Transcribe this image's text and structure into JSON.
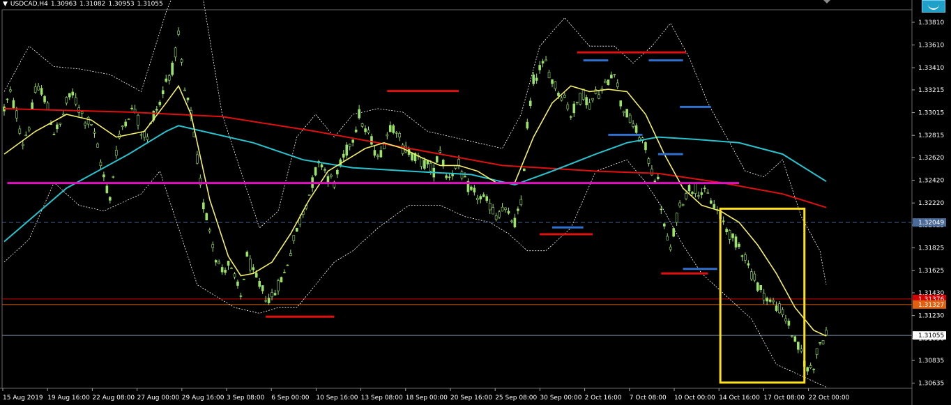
{
  "header": {
    "triangle": "▼",
    "symbol": "USDCAD,H4",
    "ohlc": [
      "1.30963",
      "1.31082",
      "1.30953",
      "1.31055"
    ]
  },
  "icons": {
    "corner_button": "chart-shift-icon",
    "top_arrow": "scroll-marker-icon"
  },
  "chart_data": {
    "type": "candlestick",
    "symbol": "USDCAD",
    "timeframe": "H4",
    "y_ticks": [
      "1.33810",
      "1.33610",
      "1.33410",
      "1.33215",
      "1.33015",
      "1.32815",
      "1.32620",
      "1.32420",
      "1.32220",
      "1.32025",
      "1.31825",
      "1.31625",
      "1.31430",
      "1.31230",
      "1.31030",
      "1.30835",
      "1.30635"
    ],
    "ylim": [
      1.3059,
      1.3392
    ],
    "x_labels": [
      "15 Aug 2019",
      "19 Aug 16:00",
      "22 Aug 08:00",
      "27 Aug 00:00",
      "29 Aug 16:00",
      "3 Sep 08:00",
      "6 Sep 00:00",
      "10 Sep 16:00",
      "13 Sep 08:00",
      "18 Sep 00:00",
      "20 Sep 16:00",
      "25 Sep 08:00",
      "30 Sep 00:00",
      "2 Oct 16:00",
      "7 Oct 08:00",
      "10 Oct 00:00",
      "14 Oct 16:00",
      "17 Oct 08:00",
      "22 Oct 00:00"
    ],
    "price_boxes": [
      {
        "label": "1.32049",
        "value": 1.32049,
        "color": "#4a6a9a",
        "line": "dashed"
      },
      {
        "label": "1.31376",
        "value": 1.31376,
        "color": "#d40000",
        "line": "solid"
      },
      {
        "label": "1.31327",
        "value": 1.31327,
        "color": "#e06010",
        "line": "solid"
      },
      {
        "label": "1.31055",
        "value": 1.31055,
        "color": "#ffffff",
        "line": "solid"
      }
    ],
    "price_path": [
      [
        0,
        1.3305
      ],
      [
        2,
        1.3318
      ],
      [
        4,
        1.33
      ],
      [
        6,
        1.3275
      ],
      [
        8,
        1.329
      ],
      [
        10,
        1.332
      ],
      [
        12,
        1.3322
      ],
      [
        14,
        1.3305
      ],
      [
        16,
        1.3285
      ],
      [
        18,
        1.329
      ],
      [
        20,
        1.331
      ],
      [
        22,
        1.3318
      ],
      [
        24,
        1.3305
      ],
      [
        26,
        1.3295
      ],
      [
        28,
        1.3292
      ],
      [
        30,
        1.327
      ],
      [
        32,
        1.3245
      ],
      [
        34,
        1.3225
      ],
      [
        36,
        1.3268
      ],
      [
        38,
        1.329
      ],
      [
        40,
        1.33
      ],
      [
        42,
        1.3305
      ],
      [
        44,
        1.3285
      ],
      [
        46,
        1.328
      ],
      [
        48,
        1.33
      ],
      [
        50,
        1.331
      ],
      [
        52,
        1.333
      ],
      [
        54,
        1.334
      ],
      [
        56,
        1.3368
      ],
      [
        58,
        1.332
      ],
      [
        60,
        1.33
      ],
      [
        62,
        1.326
      ],
      [
        64,
        1.322
      ],
      [
        66,
        1.32
      ],
      [
        68,
        1.3175
      ],
      [
        70,
        1.3162
      ],
      [
        72,
        1.3168
      ],
      [
        74,
        1.3155
      ],
      [
        76,
        1.314
      ],
      [
        78,
        1.3175
      ],
      [
        80,
        1.316
      ],
      [
        82,
        1.315
      ],
      [
        84,
        1.314
      ],
      [
        86,
        1.3138
      ],
      [
        88,
        1.315
      ],
      [
        90,
        1.316
      ],
      [
        92,
        1.318
      ],
      [
        94,
        1.3198
      ],
      [
        96,
        1.3215
      ],
      [
        98,
        1.323
      ],
      [
        100,
        1.325
      ],
      [
        102,
        1.3258
      ],
      [
        104,
        1.3245
      ],
      [
        106,
        1.324
      ],
      [
        108,
        1.3255
      ],
      [
        110,
        1.3268
      ],
      [
        112,
        1.328
      ],
      [
        114,
        1.33
      ],
      [
        116,
        1.3285
      ],
      [
        118,
        1.3278
      ],
      [
        120,
        1.326
      ],
      [
        122,
        1.3275
      ],
      [
        124,
        1.329
      ],
      [
        126,
        1.3288
      ],
      [
        128,
        1.327
      ],
      [
        130,
        1.3268
      ],
      [
        132,
        1.3262
      ],
      [
        134,
        1.3258
      ],
      [
        136,
        1.3255
      ],
      [
        138,
        1.325
      ],
      [
        140,
        1.327
      ],
      [
        142,
        1.3245
      ],
      [
        144,
        1.325
      ],
      [
        146,
        1.3255
      ],
      [
        148,
        1.324
      ],
      [
        150,
        1.3232
      ],
      [
        152,
        1.3228
      ],
      [
        154,
        1.3225
      ],
      [
        156,
        1.322
      ],
      [
        158,
        1.321
      ],
      [
        160,
        1.3218
      ],
      [
        162,
        1.321
      ],
      [
        164,
        1.3205
      ],
      [
        166,
        1.322
      ],
      [
        168,
        1.329
      ],
      [
        170,
        1.333
      ],
      [
        172,
        1.334
      ],
      [
        174,
        1.3345
      ],
      [
        176,
        1.333
      ],
      [
        178,
        1.332
      ],
      [
        180,
        1.3315
      ],
      [
        182,
        1.33
      ],
      [
        184,
        1.331
      ],
      [
        186,
        1.3318
      ],
      [
        188,
        1.3308
      ],
      [
        190,
        1.3318
      ],
      [
        192,
        1.332
      ],
      [
        194,
        1.333
      ],
      [
        196,
        1.334
      ],
      [
        198,
        1.331
      ],
      [
        200,
        1.33
      ],
      [
        202,
        1.329
      ],
      [
        204,
        1.328
      ],
      [
        206,
        1.327
      ],
      [
        208,
        1.325
      ],
      [
        210,
        1.324
      ],
      [
        212,
        1.32
      ],
      [
        214,
        1.318
      ],
      [
        216,
        1.321
      ],
      [
        218,
        1.3225
      ],
      [
        220,
        1.3235
      ],
      [
        222,
        1.3235
      ],
      [
        224,
        1.3232
      ],
      [
        226,
        1.3228
      ],
      [
        228,
        1.322
      ],
      [
        230,
        1.321
      ],
      [
        232,
        1.32
      ],
      [
        234,
        1.319
      ],
      [
        236,
        1.3185
      ],
      [
        238,
        1.3175
      ],
      [
        240,
        1.316
      ],
      [
        242,
        1.315
      ],
      [
        244,
        1.3142
      ],
      [
        246,
        1.3135
      ],
      [
        248,
        1.3132
      ],
      [
        250,
        1.3125
      ],
      [
        252,
        1.3115
      ],
      [
        254,
        1.31
      ],
      [
        256,
        1.309
      ],
      [
        258,
        1.3075
      ],
      [
        260,
        1.308
      ],
      [
        262,
        1.31
      ],
      [
        264,
        1.3105
      ]
    ],
    "n_bars": 265,
    "ma_fast": [
      [
        0,
        1.3265
      ],
      [
        10,
        1.3285
      ],
      [
        20,
        1.33
      ],
      [
        28,
        1.3295
      ],
      [
        36,
        1.328
      ],
      [
        45,
        1.3285
      ],
      [
        52,
        1.331
      ],
      [
        56,
        1.3325
      ],
      [
        60,
        1.33
      ],
      [
        66,
        1.3225
      ],
      [
        72,
        1.3175
      ],
      [
        76,
        1.3158
      ],
      [
        80,
        1.316
      ],
      [
        86,
        1.317
      ],
      [
        92,
        1.3195
      ],
      [
        98,
        1.3225
      ],
      [
        104,
        1.325
      ],
      [
        110,
        1.326
      ],
      [
        116,
        1.327
      ],
      [
        122,
        1.3275
      ],
      [
        128,
        1.327
      ],
      [
        134,
        1.3262
      ],
      [
        140,
        1.3255
      ],
      [
        146,
        1.3255
      ],
      [
        152,
        1.325
      ],
      [
        158,
        1.324
      ],
      [
        164,
        1.324
      ],
      [
        170,
        1.328
      ],
      [
        176,
        1.331
      ],
      [
        182,
        1.3325
      ],
      [
        188,
        1.332
      ],
      [
        194,
        1.3322
      ],
      [
        200,
        1.332
      ],
      [
        206,
        1.33
      ],
      [
        212,
        1.3265
      ],
      [
        218,
        1.3235
      ],
      [
        224,
        1.322
      ],
      [
        230,
        1.3215
      ],
      [
        236,
        1.3205
      ],
      [
        242,
        1.3185
      ],
      [
        248,
        1.316
      ],
      [
        254,
        1.313
      ],
      [
        260,
        1.311
      ],
      [
        264,
        1.3105
      ]
    ],
    "ma_mid": [
      [
        0,
        1.3188
      ],
      [
        20,
        1.3235
      ],
      [
        40,
        1.3265
      ],
      [
        52,
        1.3285
      ],
      [
        56,
        1.329
      ],
      [
        64,
        1.3285
      ],
      [
        80,
        1.3275
      ],
      [
        96,
        1.326
      ],
      [
        112,
        1.3253
      ],
      [
        130,
        1.325
      ],
      [
        150,
        1.3247
      ],
      [
        164,
        1.3238
      ],
      [
        176,
        1.325
      ],
      [
        190,
        1.3265
      ],
      [
        200,
        1.3275
      ],
      [
        210,
        1.328
      ],
      [
        222,
        1.3278
      ],
      [
        236,
        1.3275
      ],
      [
        250,
        1.3265
      ],
      [
        264,
        1.3241
      ]
    ],
    "ma_slow": [
      [
        0,
        1.3305
      ],
      [
        40,
        1.3302
      ],
      [
        70,
        1.3298
      ],
      [
        100,
        1.3285
      ],
      [
        130,
        1.327
      ],
      [
        160,
        1.3255
      ],
      [
        190,
        1.325
      ],
      [
        210,
        1.3248
      ],
      [
        230,
        1.324
      ],
      [
        250,
        1.323
      ],
      [
        264,
        1.3218
      ]
    ],
    "bb_upper": [
      [
        0,
        1.332
      ],
      [
        8,
        1.336
      ],
      [
        16,
        1.3342
      ],
      [
        24,
        1.334
      ],
      [
        34,
        1.3335
      ],
      [
        44,
        1.332
      ],
      [
        52,
        1.339
      ],
      [
        58,
        1.343
      ],
      [
        64,
        1.34
      ],
      [
        70,
        1.33
      ],
      [
        76,
        1.325
      ],
      [
        82,
        1.32
      ],
      [
        88,
        1.3215
      ],
      [
        94,
        1.328
      ],
      [
        100,
        1.33
      ],
      [
        106,
        1.328
      ],
      [
        112,
        1.33
      ],
      [
        120,
        1.3305
      ],
      [
        128,
        1.3302
      ],
      [
        136,
        1.3285
      ],
      [
        144,
        1.328
      ],
      [
        152,
        1.3275
      ],
      [
        160,
        1.327
      ],
      [
        166,
        1.33
      ],
      [
        172,
        1.336
      ],
      [
        180,
        1.3385
      ],
      [
        188,
        1.336
      ],
      [
        196,
        1.336
      ],
      [
        202,
        1.3345
      ],
      [
        208,
        1.336
      ],
      [
        214,
        1.338
      ],
      [
        220,
        1.335
      ],
      [
        226,
        1.331
      ],
      [
        232,
        1.328
      ],
      [
        238,
        1.325
      ],
      [
        244,
        1.3245
      ],
      [
        250,
        1.326
      ],
      [
        256,
        1.321
      ],
      [
        262,
        1.318
      ],
      [
        264,
        1.315
      ]
    ],
    "bb_lower": [
      [
        0,
        1.317
      ],
      [
        8,
        1.319
      ],
      [
        16,
        1.324
      ],
      [
        24,
        1.322
      ],
      [
        32,
        1.3215
      ],
      [
        44,
        1.323
      ],
      [
        50,
        1.325
      ],
      [
        56,
        1.32
      ],
      [
        62,
        1.315
      ],
      [
        68,
        1.314
      ],
      [
        74,
        1.313
      ],
      [
        82,
        1.3125
      ],
      [
        88,
        1.313
      ],
      [
        94,
        1.313
      ],
      [
        100,
        1.315
      ],
      [
        106,
        1.317
      ],
      [
        112,
        1.318
      ],
      [
        120,
        1.32
      ],
      [
        130,
        1.322
      ],
      [
        140,
        1.322
      ],
      [
        148,
        1.321
      ],
      [
        156,
        1.3205
      ],
      [
        162,
        1.3195
      ],
      [
        168,
        1.318
      ],
      [
        174,
        1.318
      ],
      [
        182,
        1.32
      ],
      [
        190,
        1.325
      ],
      [
        200,
        1.326
      ],
      [
        206,
        1.324
      ],
      [
        212,
        1.3215
      ],
      [
        218,
        1.3185
      ],
      [
        224,
        1.316
      ],
      [
        232,
        1.314
      ],
      [
        240,
        1.312
      ],
      [
        248,
        1.308
      ],
      [
        256,
        1.307
      ],
      [
        264,
        1.306
      ]
    ],
    "magenta_line": {
      "value": 1.32395,
      "from": 1,
      "to": 236
    },
    "segments": [
      {
        "color": "#e01010",
        "value": 1.3122,
        "from": 84,
        "to": 106
      },
      {
        "color": "#e01010",
        "value": 1.33205,
        "from": 123,
        "to": 146
      },
      {
        "color": "#e01010",
        "value": 1.31945,
        "from": 172,
        "to": 189
      },
      {
        "color": "#e01010",
        "value": 1.33545,
        "from": 184,
        "to": 219
      },
      {
        "color": "#e01010",
        "value": 1.316,
        "from": 211,
        "to": 226
      },
      {
        "color": "#3070d0",
        "value": 1.33475,
        "from": 186,
        "to": 194
      },
      {
        "color": "#3070d0",
        "value": 1.33475,
        "from": 207,
        "to": 218
      },
      {
        "color": "#3070d0",
        "value": 1.3282,
        "from": 194,
        "to": 205
      },
      {
        "color": "#3070d0",
        "value": 1.3265,
        "from": 210,
        "to": 218
      },
      {
        "color": "#3070d0",
        "value": 1.33065,
        "from": 217,
        "to": 227
      },
      {
        "color": "#3070d0",
        "value": 1.3164,
        "from": 218,
        "to": 229
      },
      {
        "color": "#3070d0",
        "value": 1.32005,
        "from": 176,
        "to": 186
      }
    ],
    "highlight_box": {
      "color": "#ffe01c",
      "from_bar": 230,
      "to_bar": 257,
      "top": 1.3217,
      "bottom": 1.3064
    },
    "colors": {
      "background": "#000000",
      "bull": "#9be36a",
      "bear": "#9be36a",
      "ma_fast": "#f5f06a",
      "ma_mid": "#27c4cf",
      "ma_slow": "#e01010",
      "bands": "#ffffff",
      "magenta": "#e010c0",
      "axis_text": "#ffffff"
    }
  }
}
